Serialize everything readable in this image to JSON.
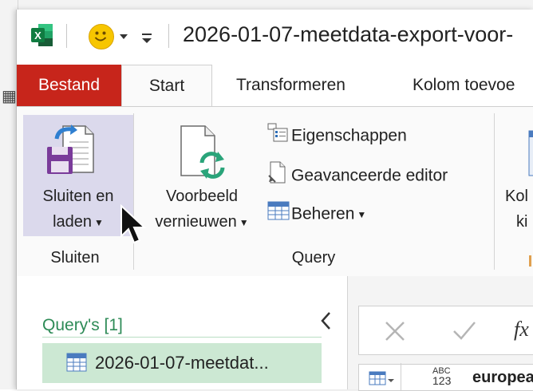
{
  "app": "Excel Power Query Editor",
  "title": "2026-01-07-meetdata-export-voor-",
  "tabs": [
    {
      "label": "Bestand"
    },
    {
      "label": "Start"
    },
    {
      "label": "Transformeren"
    },
    {
      "label": "Kolom toevoe"
    }
  ],
  "ribbon": {
    "close_load": {
      "line1": "Sluiten en",
      "line2": "laden"
    },
    "refresh_preview": {
      "line1": "Voorbeeld",
      "line2": "vernieuwen"
    },
    "properties": "Eigenschappen",
    "advanced_editor": "Geavanceerde editor",
    "manage": "Beheren",
    "choose_columns": {
      "line1": "Kol",
      "line2": "ki"
    },
    "group_close": "Sluiten",
    "group_query": "Query"
  },
  "queries": {
    "title": "Query's [1]",
    "items": [
      {
        "label": "2026-01-07-meetdat..."
      }
    ]
  },
  "formula": {
    "fx": "fx"
  },
  "grid": {
    "column_type_top": "ABC",
    "column_type_bottom": "123",
    "column_name": "europea"
  },
  "colors": {
    "file_tab": "#c7251b",
    "selected_button": "#dbd9ec",
    "query_selected": "#cce8d3",
    "query_title": "#2e8b57",
    "excel_green": "#1e7145"
  }
}
